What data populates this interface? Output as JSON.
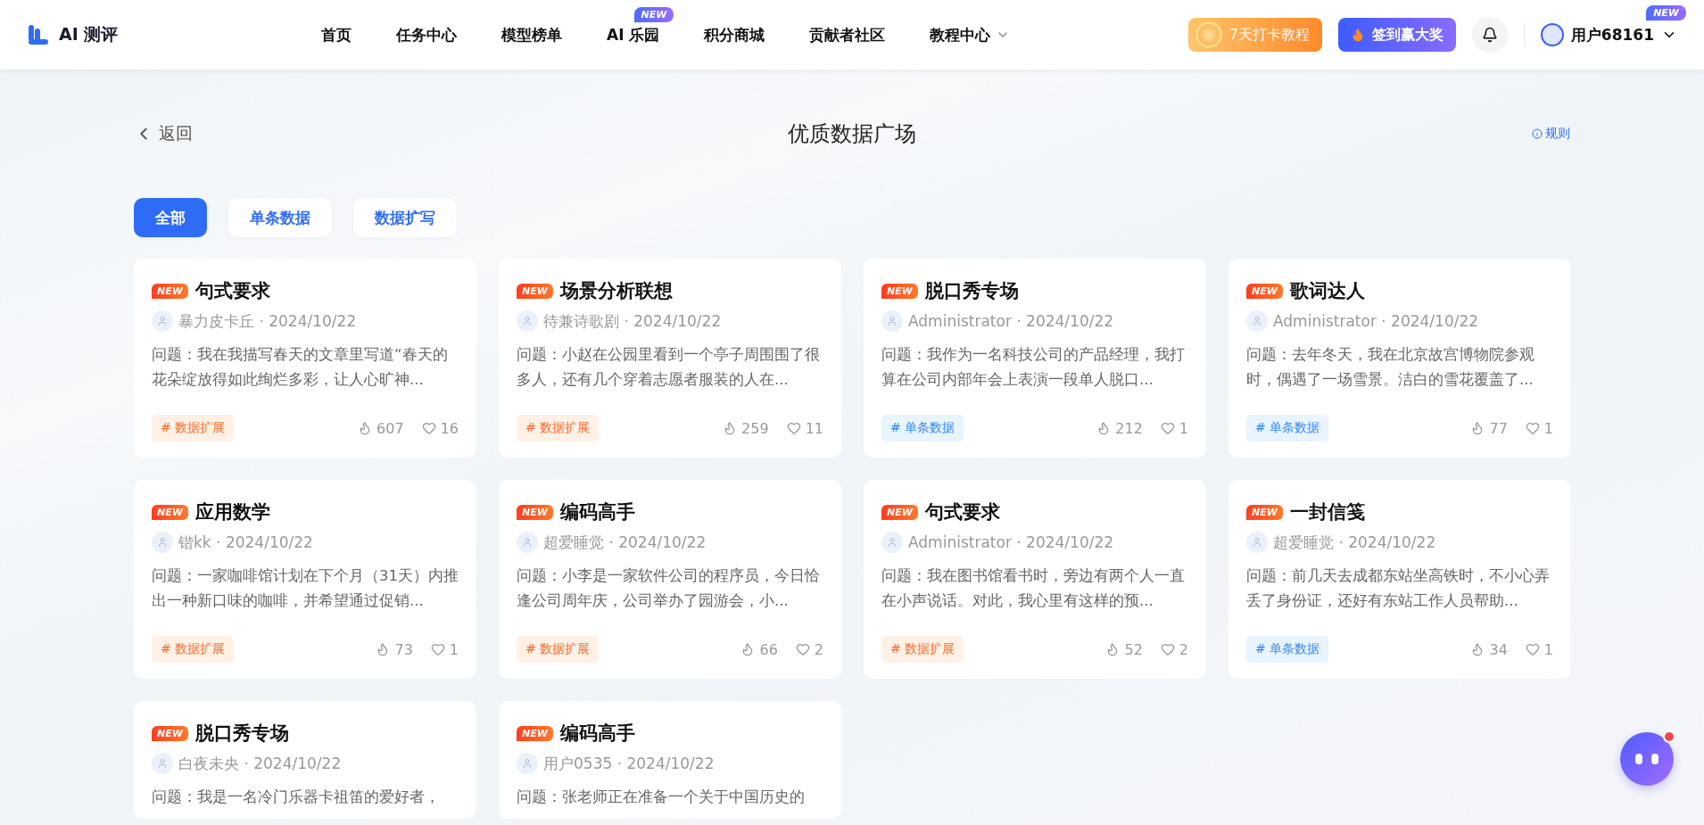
{
  "header": {
    "logo_text": "AI 测评",
    "nav": [
      {
        "label": "首页"
      },
      {
        "label": "任务中心"
      },
      {
        "label": "模型榜单"
      },
      {
        "label": "AI 乐园",
        "badge": "NEW"
      },
      {
        "label": "积分商城"
      },
      {
        "label": "贡献者社区"
      },
      {
        "label": "教程中心",
        "dropdown": true
      }
    ],
    "tutorial_button": "7天打卡教程",
    "checkin_button": "签到赢大奖",
    "user": {
      "name": "用户68161",
      "badge": "NEW"
    }
  },
  "page": {
    "back": "返回",
    "title": "优质数据广场",
    "rules": "规则"
  },
  "filters": [
    {
      "label": "全部",
      "selected": true
    },
    {
      "label": "单条数据",
      "selected": false
    },
    {
      "label": "数据扩写",
      "selected": false
    }
  ],
  "cards": [
    {
      "badge": "NEW",
      "title": "句式要求",
      "author": "暴力皮卡丘 · 2024/10/22",
      "question": "问题：我在我描写春天的文章里写道“春天的花朵绽放得如此绚烂多彩，让人心旷神...",
      "tag": "# 数据扩展",
      "kind": "expand",
      "views": "607",
      "likes": "16"
    },
    {
      "badge": "NEW",
      "title": "场景分析联想",
      "author": "待兼诗歌剧 · 2024/10/22",
      "question": "问题：小赵在公园里看到一个亭子周围围了很多人，还有几个穿着志愿者服装的人在...",
      "tag": "# 数据扩展",
      "kind": "expand",
      "views": "259",
      "likes": "11"
    },
    {
      "badge": "NEW",
      "title": "脱口秀专场",
      "author": "Administrator · 2024/10/22",
      "question": "问题：我作为一名科技公司的产品经理，我打算在公司内部年会上表演一段单人脱口...",
      "tag": "# 单条数据",
      "kind": "single",
      "views": "212",
      "likes": "1"
    },
    {
      "badge": "NEW",
      "title": "歌词达人",
      "author": "Administrator · 2024/10/22",
      "question": "问题：去年冬天，我在北京故宫博物院参观时，偶遇了一场雪景。洁白的雪花覆盖了...",
      "tag": "# 单条数据",
      "kind": "single",
      "views": "77",
      "likes": "1"
    },
    {
      "badge": "NEW",
      "title": "应用数学",
      "author": "锴kk · 2024/10/22",
      "question": "问题：一家咖啡馆计划在下个月（31天）内推出一种新口味的咖啡，并希望通过促销...",
      "tag": "# 数据扩展",
      "kind": "expand",
      "views": "73",
      "likes": "1"
    },
    {
      "badge": "NEW",
      "title": "编码高手",
      "author": "超爱睡觉 · 2024/10/22",
      "question": "问题：小李是一家软件公司的程序员，今日恰逢公司周年庆，公司举办了园游会，小...",
      "tag": "# 数据扩展",
      "kind": "expand",
      "views": "66",
      "likes": "2"
    },
    {
      "badge": "NEW",
      "title": "句式要求",
      "author": "Administrator · 2024/10/22",
      "question": "问题：我在图书馆看书时，旁边有两个人一直在小声说话。对此，我心里有这样的预...",
      "tag": "# 数据扩展",
      "kind": "expand",
      "views": "52",
      "likes": "2"
    },
    {
      "badge": "NEW",
      "title": "一封信笺",
      "author": "超爱睡觉 · 2024/10/22",
      "question": "问题：前几天去成都东站坐高铁时，不小心弄丢了身份证，还好有东站工作人员帮助...",
      "tag": "# 单条数据",
      "kind": "single",
      "views": "34",
      "likes": "1"
    },
    {
      "badge": "NEW",
      "title": "脱口秀专场",
      "author": "白夜未央 · 2024/10/22",
      "question": "问题：我是一名冷门乐器卡祖笛的爱好者，",
      "kind": "cut"
    },
    {
      "badge": "NEW",
      "title": "编码高手",
      "author": "用户0535 · 2024/10/22",
      "question": "问题：张老师正在准备一个关于中国历史的",
      "kind": "cut"
    }
  ]
}
